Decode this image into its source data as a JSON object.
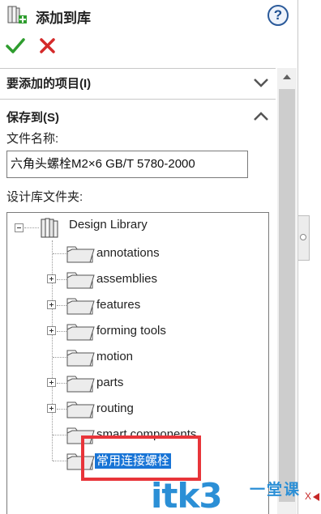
{
  "header": {
    "title": "添加到库",
    "help_symbol": "?"
  },
  "actions": {
    "ok_icon": "check-icon",
    "cancel_icon": "x-icon",
    "ok_color": "#2e9d2e",
    "cancel_color": "#d42a2a"
  },
  "sections": {
    "items_to_add": "要添加的项目(I)",
    "save_to": "保存到(S)"
  },
  "fields": {
    "file_name_label": "文件名称:",
    "file_name_value": "六角头螺栓M2×6 GB/T 5780-2000",
    "folder_label": "设计库文件夹:"
  },
  "tree": {
    "root": "Design Library",
    "items": [
      {
        "label": "annotations",
        "expandable": false
      },
      {
        "label": "assemblies",
        "expandable": true
      },
      {
        "label": "features",
        "expandable": true
      },
      {
        "label": "forming tools",
        "expandable": true
      },
      {
        "label": "motion",
        "expandable": false
      },
      {
        "label": "parts",
        "expandable": true
      },
      {
        "label": "routing",
        "expandable": true
      },
      {
        "label": "smart components",
        "expandable": false
      },
      {
        "label": "常用连接螺栓",
        "expandable": false,
        "selected": true
      }
    ]
  },
  "watermark": {
    "brand": "itk3",
    "suffix": "一堂课"
  },
  "axis_marker": "X"
}
